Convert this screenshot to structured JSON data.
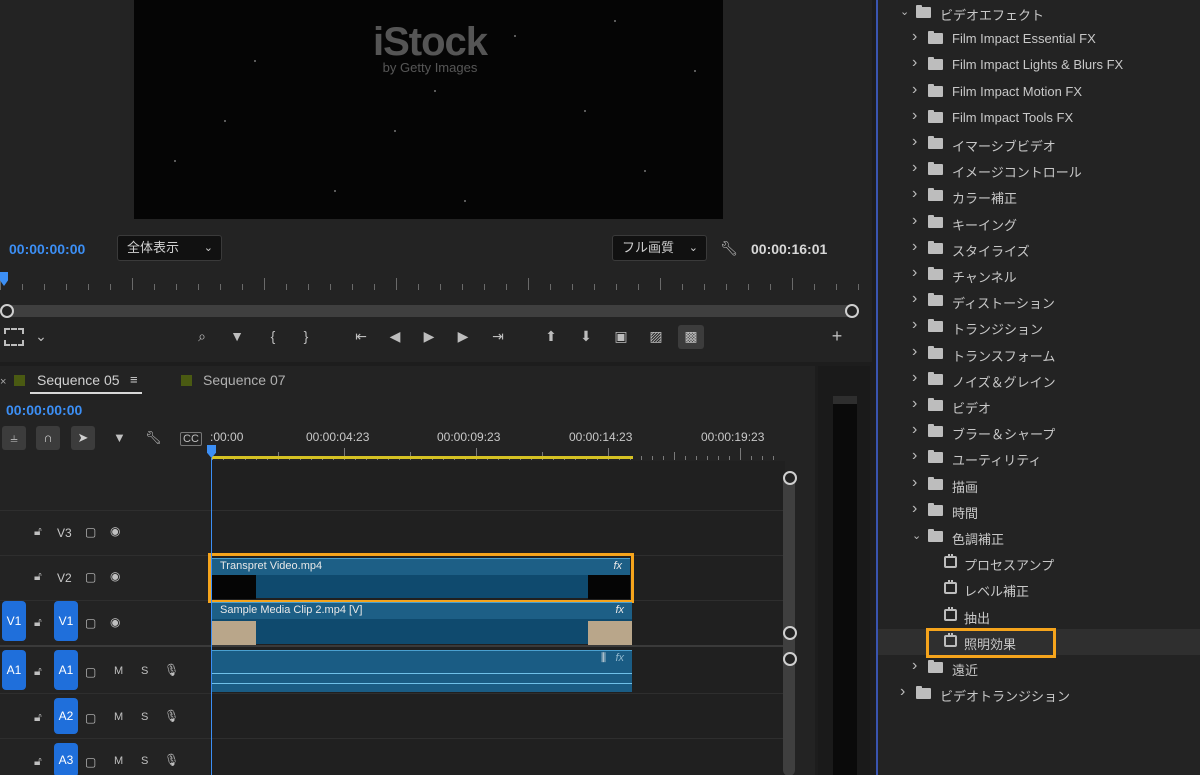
{
  "monitor": {
    "watermark_main": "iStock",
    "watermark_sub": "by Getty Images",
    "current_time": "00:00:00:00",
    "fit_dropdown": "全体表示",
    "quality_dropdown": "フル画質",
    "duration": "00:00:16:01"
  },
  "timeline": {
    "tabs": [
      {
        "label": "Sequence 05",
        "active": true
      },
      {
        "label": "Sequence 07",
        "active": false
      }
    ],
    "current_time": "00:00:00:00",
    "ruler_labels": [
      ":00:00",
      "00:00:04:23",
      "00:00:09:23",
      "00:00:14:23",
      "00:00:19:23"
    ],
    "tracks": {
      "v3": "V3",
      "v2": "V2",
      "v1_source": "V1",
      "v1": "V1",
      "a1_source": "A1",
      "a1": "A1",
      "a2": "A2",
      "a3": "A3",
      "mute": "M",
      "solo": "S"
    },
    "clips": {
      "v2_name": "Transpret Video.mp4",
      "v1_name": "Sample Media Clip 2.mp4 [V]",
      "fx_badge": "fx"
    }
  },
  "effects": {
    "items": [
      {
        "label": "ビデオエフェクト",
        "level": 1,
        "expanded": true,
        "type": "folder"
      },
      {
        "label": "Film Impact Essential FX",
        "level": 2,
        "type": "folder"
      },
      {
        "label": "Film Impact Lights & Blurs FX",
        "level": 2,
        "type": "folder"
      },
      {
        "label": "Film Impact Motion FX",
        "level": 2,
        "type": "folder"
      },
      {
        "label": "Film Impact Tools FX",
        "level": 2,
        "type": "folder"
      },
      {
        "label": "イマーシブビデオ",
        "level": 2,
        "type": "folder"
      },
      {
        "label": "イメージコントロール",
        "level": 2,
        "type": "folder"
      },
      {
        "label": "カラー補正",
        "level": 2,
        "type": "folder"
      },
      {
        "label": "キーイング",
        "level": 2,
        "type": "folder"
      },
      {
        "label": "スタイライズ",
        "level": 2,
        "type": "folder"
      },
      {
        "label": "チャンネル",
        "level": 2,
        "type": "folder"
      },
      {
        "label": "ディストーション",
        "level": 2,
        "type": "folder"
      },
      {
        "label": "トランジション",
        "level": 2,
        "type": "folder"
      },
      {
        "label": "トランスフォーム",
        "level": 2,
        "type": "folder"
      },
      {
        "label": "ノイズ＆グレイン",
        "level": 2,
        "type": "folder"
      },
      {
        "label": "ビデオ",
        "level": 2,
        "type": "folder"
      },
      {
        "label": "ブラー＆シャープ",
        "level": 2,
        "type": "folder"
      },
      {
        "label": "ユーティリティ",
        "level": 2,
        "type": "folder"
      },
      {
        "label": "描画",
        "level": 2,
        "type": "folder"
      },
      {
        "label": "時間",
        "level": 2,
        "type": "folder"
      },
      {
        "label": "色調補正",
        "level": 2,
        "expanded": true,
        "type": "folder"
      },
      {
        "label": "プロセスアンプ",
        "level": 3,
        "type": "effect"
      },
      {
        "label": "レベル補正",
        "level": 3,
        "type": "effect"
      },
      {
        "label": "抽出",
        "level": 3,
        "type": "effect"
      },
      {
        "label": "照明効果",
        "level": 3,
        "type": "effect",
        "selected": true
      },
      {
        "label": "遠近",
        "level": 2,
        "type": "folder"
      },
      {
        "label": "ビデオトランジション",
        "level": 1,
        "type": "folder"
      }
    ]
  },
  "colors": {
    "accent_blue": "#3c8ff5",
    "clip_blue": "#1d5f86",
    "highlight_orange": "#f5a41c",
    "work_area_yellow": "#d6c223"
  }
}
